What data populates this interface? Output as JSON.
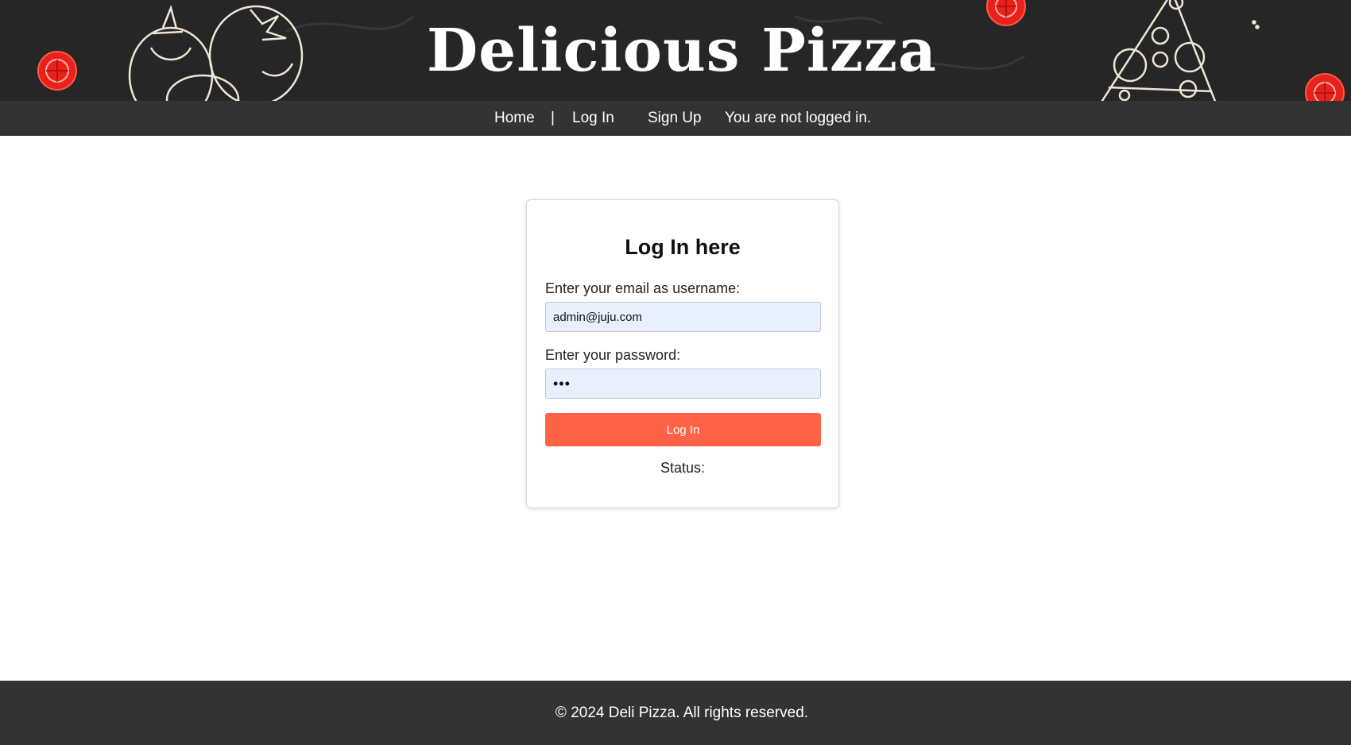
{
  "header": {
    "title": "Delicious Pizza"
  },
  "nav": {
    "home": "Home",
    "separator": "|",
    "login": "Log In",
    "signup": "Sign Up",
    "login_status": "You are not logged in."
  },
  "login_form": {
    "title": "Log In here",
    "email_label": "Enter your email as username:",
    "email_value": "admin@juju.com",
    "password_label": "Enter your password:",
    "password_value": "•••",
    "submit_label": "Log In",
    "status_label": "Status:"
  },
  "footer": {
    "copyright": "© 2024 Deli Pizza. All rights reserved."
  },
  "colors": {
    "banner_bg": "#262626",
    "nav_bg": "#333333",
    "button_accent": "#ff6347",
    "input_bg": "#e8f0fe",
    "tomato_red": "#e8211c"
  },
  "icons": [
    "tomato-slice-icon",
    "tomato-illustration-icon",
    "pizza-slice-illustration-icon"
  ]
}
